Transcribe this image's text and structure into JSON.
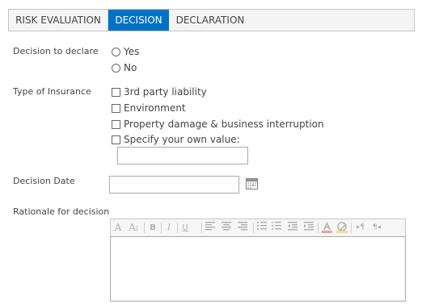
{
  "tabs": [
    {
      "label": "RISK EVALUATION",
      "active": false
    },
    {
      "label": "DECISION",
      "active": true
    },
    {
      "label": "DECLARATION",
      "active": false
    }
  ],
  "decision": {
    "label": "Decision to declare",
    "options": [
      "Yes",
      "No"
    ],
    "selected": null
  },
  "insurance": {
    "label": "Type of Insurance",
    "options": [
      "3rd party liability",
      "Environment",
      "Property damage & business interruption",
      "Specify your own value:"
    ],
    "own_value": ""
  },
  "decision_date": {
    "label": "Decision Date",
    "value": "",
    "icon": "calendar-icon"
  },
  "rationale": {
    "label": "Rationale for decision",
    "value": "",
    "toolbar_icons": [
      "font-family-icon",
      "font-size-icon",
      "bold-icon",
      "italic-icon",
      "underline-icon",
      "align-left-icon",
      "align-center-icon",
      "align-right-icon",
      "numbered-list-icon",
      "bulleted-list-icon",
      "decrease-indent-icon",
      "increase-indent-icon",
      "text-color-icon",
      "highlight-color-icon",
      "ltr-icon",
      "rtl-icon"
    ]
  },
  "colors": {
    "accent": "#0072c6",
    "text": "#444444",
    "border": "#ababab",
    "toolbar_icon": "#b0b0b0"
  }
}
